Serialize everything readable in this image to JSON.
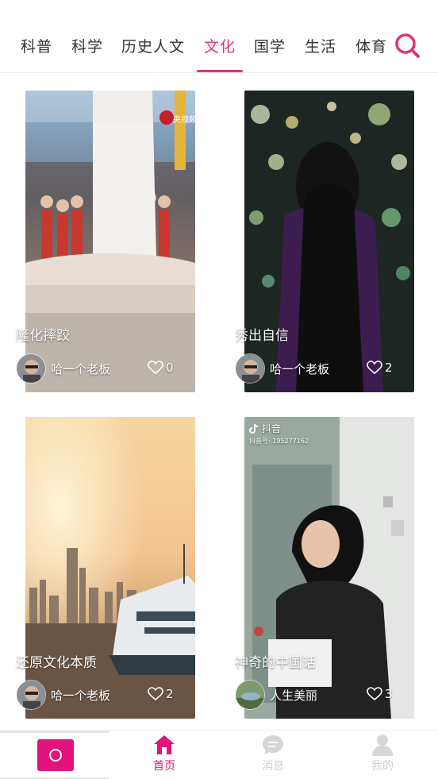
{
  "tabs": [
    {
      "label": "科普",
      "active": false
    },
    {
      "label": "科学",
      "active": false
    },
    {
      "label": "历史人文",
      "active": false
    },
    {
      "label": "文化",
      "active": true
    },
    {
      "label": "国学",
      "active": false
    },
    {
      "label": "生活",
      "active": false
    },
    {
      "label": "体育",
      "active": false
    }
  ],
  "search": {
    "icon": "search-icon",
    "color": "#e2327c"
  },
  "feed": [
    {
      "title": "隆化摔跤",
      "author": "哈一个老板",
      "likes": "0"
    },
    {
      "title": "秀出自信",
      "author": "哈一个老板",
      "likes": "2"
    },
    {
      "title": "还原文化本质",
      "author": "哈一个老板",
      "likes": "2"
    },
    {
      "title": "神奇的中国话",
      "author": "人生美丽",
      "likes": "3",
      "watermark": "抖音",
      "watermark_id": "抖音号: 195277162"
    }
  ],
  "thumbnail_overlay": {
    "cctv_badge": "央视频"
  },
  "bottom_nav": {
    "record": {
      "icon": "record-icon"
    },
    "items": [
      {
        "label": "首页",
        "icon": "home-icon",
        "active": true
      },
      {
        "label": "消息",
        "icon": "message-icon",
        "active": false
      },
      {
        "label": "我的",
        "icon": "user-icon",
        "active": false
      }
    ]
  },
  "colors": {
    "accent": "#e2327c",
    "record": "#e2137d",
    "inactive": "#cfcfcf"
  }
}
